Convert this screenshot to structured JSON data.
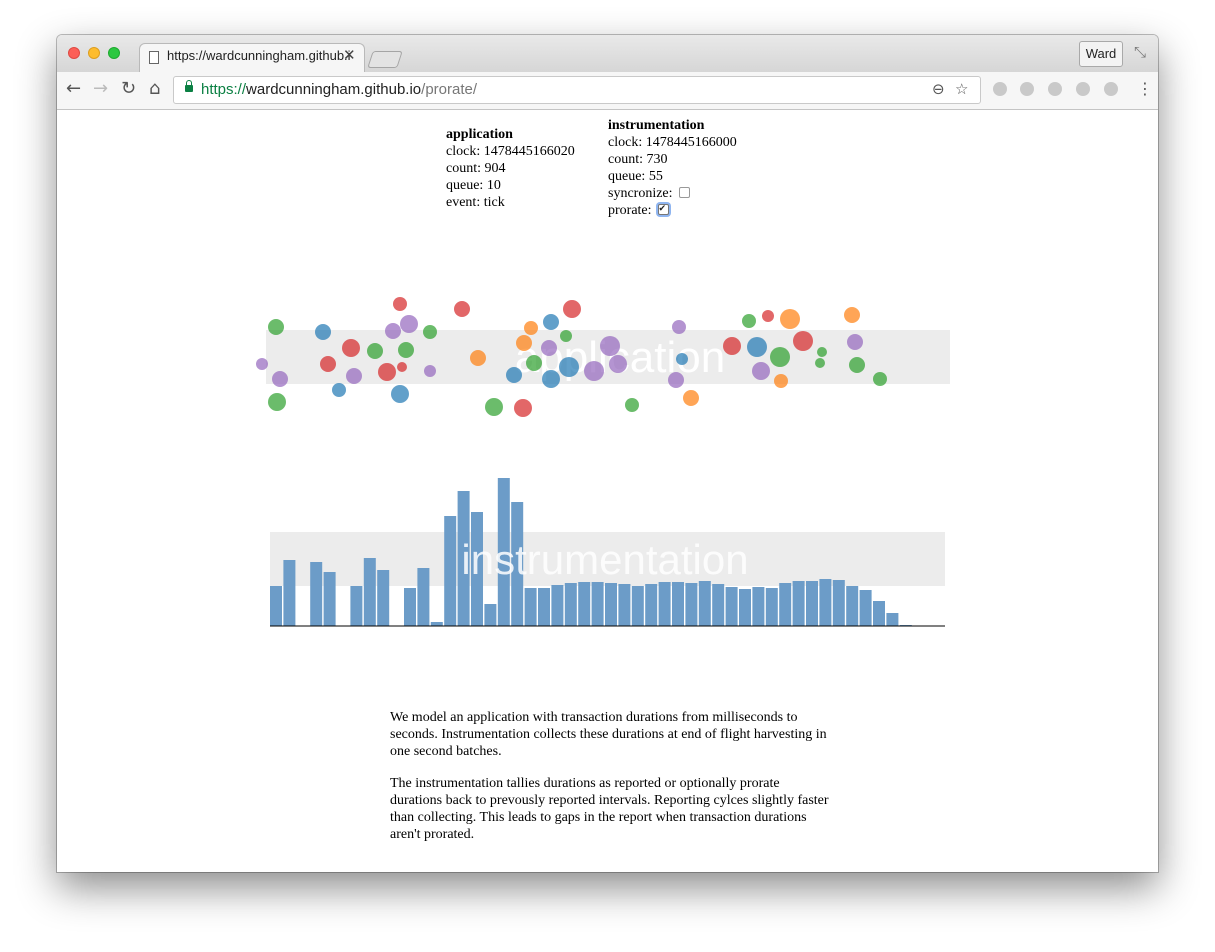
{
  "browser": {
    "tab_title": "https://wardcunningham.github.io/prorate/",
    "profile": "Ward",
    "url_scheme": "https://",
    "url_host": "wardcunningham.github.io",
    "url_path": "/prorate/",
    "icons": [
      "page-icon",
      "close-icon",
      "back-icon",
      "forward-icon",
      "reload-icon",
      "home-icon",
      "lock-icon",
      "zoom-icon",
      "star-icon",
      "menu-icon",
      "fullscreen-icon"
    ]
  },
  "application": {
    "title": "application",
    "clock": "clock: 1478445166020",
    "count": "count: 904",
    "queue": "queue: 10",
    "event": "event: tick"
  },
  "instrumentation": {
    "title": "instrumentation",
    "clock": "clock: 1478445166000",
    "count": "count: 730",
    "queue": "queue: 55",
    "syncronize_label": "syncronize:",
    "syncronize_checked": false,
    "prorate_label": "prorate:",
    "prorate_checked": true
  },
  "application_band_label": "application",
  "instrumentation_band_label": "instrumentation",
  "colors": {
    "red": "#d62728",
    "blue": "#1f77b4",
    "green": "#2ca02c",
    "orange": "#ff7f0e",
    "purple": "#9467bd",
    "bar": "#6c9cc8",
    "band": "#ececec"
  },
  "chart_data": {
    "type": "bar",
    "values": [
      40,
      66,
      0,
      64,
      54,
      0,
      40,
      68,
      56,
      0,
      38,
      58,
      4,
      110,
      135,
      114,
      22,
      148,
      124,
      38,
      38,
      41,
      43,
      44,
      44,
      43,
      42,
      40,
      42,
      44,
      44,
      43,
      45,
      42,
      39,
      37,
      39,
      38,
      43,
      45,
      45,
      47,
      46,
      40,
      36,
      25,
      13,
      1
    ]
  },
  "paragraphs": [
    "We model an application with transaction durations from milliseconds to seconds. Instrumentation collects these durations at end of flight harvesting in one second batches.",
    "The instrumentation tallies durations as reported or optionally prorate durations back to prevously reported intervals. Reporting cylces slightly faster than collecting. This leads to gaps in the report when transaction durations aren't prorated."
  ]
}
